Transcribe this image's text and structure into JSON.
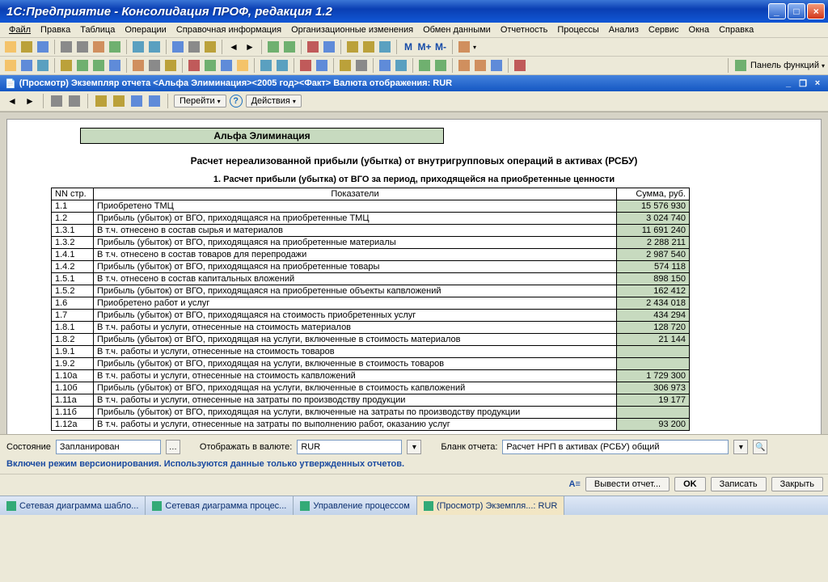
{
  "window": {
    "title": "1С:Предприятие - Консолидация ПРОФ, редакция 1.2"
  },
  "menu": [
    "Файл",
    "Правка",
    "Таблица",
    "Операции",
    "Справочная информация",
    "Организационные изменения",
    "Обмен данными",
    "Отчетность",
    "Процессы",
    "Анализ",
    "Сервис",
    "Окна",
    "Справка"
  ],
  "toolbar2_funcpanel": "Панель функций",
  "doc_window": {
    "title": "(Просмотр) Экземпляр отчета <Альфа Элиминация><2005 год><Факт> Валюта отображения: RUR"
  },
  "subtoolbar": {
    "goto": "Перейти",
    "actions": "Действия"
  },
  "report": {
    "badge": "Альфа Элиминация",
    "title": "Расчет нереализованной прибыли (убытка) от внутригрупповых операций в активах (РСБУ)",
    "section1": "1. Расчет прибыли (убытка) от ВГО за период, приходящейся на приобретенные ценности",
    "col_nn": "NN стр.",
    "col_ind": "Показатели",
    "col_sum": "Сумма, руб."
  },
  "rows": [
    {
      "n": "1.1",
      "t": "Приобретено ТМЦ",
      "v": "15 576 930"
    },
    {
      "n": "1.2",
      "t": "Прибыль (убыток) от ВГО, приходящаяся на приобретенные ТМЦ",
      "v": "3 024 740"
    },
    {
      "n": "1.3.1",
      "t": "В т.ч. отнесено в состав сырья и материалов",
      "v": "11 691 240"
    },
    {
      "n": "1.3.2",
      "t": "Прибыль (убыток) от ВГО, приходящаяся на приобретенные материалы",
      "v": "2 288 211"
    },
    {
      "n": "1.4.1",
      "t": "В т.ч. отнесено в состав товаров для перепродажи",
      "v": "2 987 540"
    },
    {
      "n": "1.4.2",
      "t": "Прибыль (убыток) от ВГО, приходящаяся на приобретенные товары",
      "v": "574 118"
    },
    {
      "n": "1.5.1",
      "t": "В т.ч. отнесено в состав капитальных вложений",
      "v": "898 150"
    },
    {
      "n": "1.5.2",
      "t": "Прибыль (убыток) от ВГО, приходящаяся на приобретенные объекты капвложений",
      "v": "162 412"
    },
    {
      "n": "1.6",
      "t": "Приобретено работ и услуг",
      "v": "2 434 018"
    },
    {
      "n": "1.7",
      "t": "Прибыль (убыток) от ВГО, приходящаяся на стоимость приобретенных услуг",
      "v": "434 294"
    },
    {
      "n": "1.8.1",
      "t": "В т.ч. работы и услуги, отнесенные на стоимость материалов",
      "v": "128 720"
    },
    {
      "n": "1.8.2",
      "t": "Прибыль (убыток) от ВГО, приходящая на услуги, включенные в стоимость материалов",
      "v": "21 144"
    },
    {
      "n": "1.9.1",
      "t": "В т.ч. работы и услуги, отнесенные на стоимость товаров",
      "v": ""
    },
    {
      "n": "1.9.2",
      "t": "Прибыль (убыток) от ВГО, приходящая на услуги, включенные в стоимость товаров",
      "v": ""
    },
    {
      "n": "1.10а",
      "t": "В т.ч. работы и услуги, отнесенные на стоимость капвложений",
      "v": "1 729 300"
    },
    {
      "n": "1.10б",
      "t": "Прибыль (убыток) от ВГО, приходящая на услуги, включенные в стоимость капвложений",
      "v": "306 973"
    },
    {
      "n": "1.11а",
      "t": "В т.ч. работы и услуги, отнесенные на затраты по производству продукции",
      "v": "19 177"
    },
    {
      "n": "1.11б",
      "t": "Прибыль (убыток) от ВГО, приходящая на услуги, включенные на затраты по производству продукции",
      "v": ""
    },
    {
      "n": "1.12а",
      "t": "В т.ч. работы и услуги, отнесенные на затраты по выполнению работ, оказанию услуг",
      "v": "93 200"
    }
  ],
  "status": {
    "label_state": "Состояние",
    "state_value": "Запланирован",
    "label_currency": "Отображать в валюте:",
    "currency_value": "RUR",
    "label_blank": "Бланк отчета:",
    "blank_value": "Расчет НРП в активах (РСБУ) общий"
  },
  "info_msg": "Включен режим версионирования. Используются данные только утвержденных отчетов.",
  "actions": {
    "output": "Вывести отчет...",
    "ok": "OK",
    "save": "Записать",
    "close": "Закрыть"
  },
  "tasks": [
    "Сетевая диаграмма шабло...",
    "Сетевая диаграмма процес...",
    "Управление процессом",
    "(Просмотр) Экземпля...: RUR"
  ]
}
